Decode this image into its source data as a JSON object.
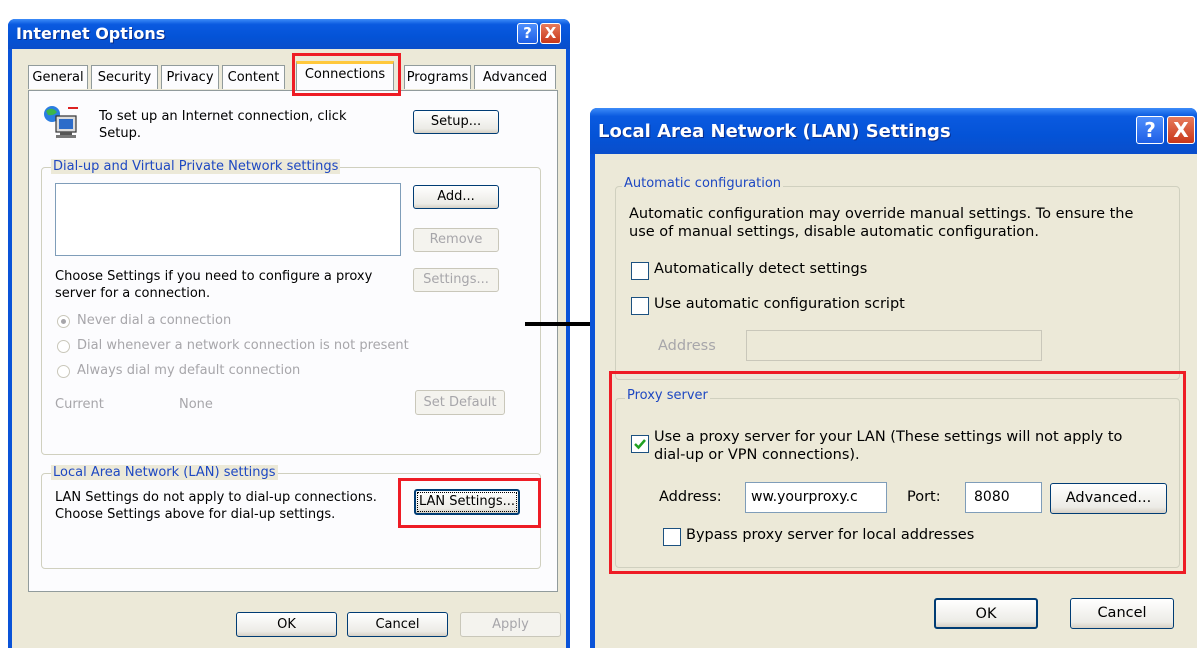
{
  "internet_options": {
    "title": "Internet Options",
    "help_btn": "?",
    "close_btn": "X",
    "tabs": [
      "General",
      "Security",
      "Privacy",
      "Content",
      "Connections",
      "Programs",
      "Advanced"
    ],
    "setup_text_line1": "To set up an Internet connection, click",
    "setup_text_line2": "Setup.",
    "setup_button": "Setup...",
    "dialup_group": "Dial-up and Virtual Private Network settings",
    "add_button": "Add...",
    "remove_button": "Remove",
    "settings_text_line1": "Choose Settings if you need to configure a proxy",
    "settings_text_line2": "server for a connection.",
    "settings_button": "Settings...",
    "radio_never": "Never dial a connection",
    "radio_whenever": "Dial whenever a network connection is not present",
    "radio_always": "Always dial my default connection",
    "current_label": "Current",
    "current_value": "None",
    "set_default_button": "Set Default",
    "lan_group": "Local Area Network (LAN) settings",
    "lan_text_line1": "LAN Settings do not apply to dial-up connections.",
    "lan_text_line2": "Choose Settings above for dial-up settings.",
    "lan_settings_button": "LAN Settings...",
    "ok_button": "OK",
    "cancel_button": "Cancel",
    "apply_button": "Apply"
  },
  "lan_settings": {
    "title": "Local Area Network (LAN) Settings",
    "help_btn": "?",
    "close_btn": "X",
    "auto_group": "Automatic configuration",
    "auto_text_line1": "Automatic configuration may override manual settings.  To ensure the",
    "auto_text_line2": "use of manual settings, disable automatic configuration.",
    "auto_detect_label": "Automatically detect settings",
    "auto_script_label": "Use automatic configuration script",
    "address_label": "Address",
    "address_value": "",
    "proxy_group": "Proxy server",
    "use_proxy_label_line1": "Use a proxy server for your LAN (These settings will not apply to",
    "use_proxy_label_line2": "dial-up or VPN connections).",
    "use_proxy_checked": true,
    "proxy_address_label": "Address:",
    "proxy_address_value": "ww.yourproxy.c",
    "port_label": "Port:",
    "port_value": "8080",
    "advanced_button": "Advanced...",
    "bypass_label": "Bypass proxy server for local addresses",
    "ok_button": "OK",
    "cancel_button": "Cancel"
  },
  "colors": {
    "highlight": "#ee1c25",
    "titlebar": "#0453d7",
    "dialog_bg": "#ece9d8"
  }
}
